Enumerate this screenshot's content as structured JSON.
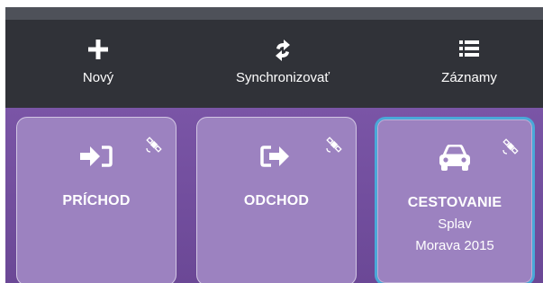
{
  "toolbar": {
    "new_label": "Nový",
    "sync_label": "Synchronizovať",
    "records_label": "Záznamy"
  },
  "cards": [
    {
      "title": "PRÍCHOD",
      "icon": "sign-in-icon"
    },
    {
      "title": "ODCHOD",
      "icon": "sign-out-icon"
    },
    {
      "title": "CESTOVANIE",
      "subtitle_1": "Splav",
      "subtitle_2": "Morava 2015",
      "icon": "car-icon",
      "active": true
    }
  ],
  "colors": {
    "toolbar_bg": "#303238",
    "content_bg": "#6e4a98",
    "card_bg": "#9c82c0",
    "active_border": "#4aa8d8"
  }
}
